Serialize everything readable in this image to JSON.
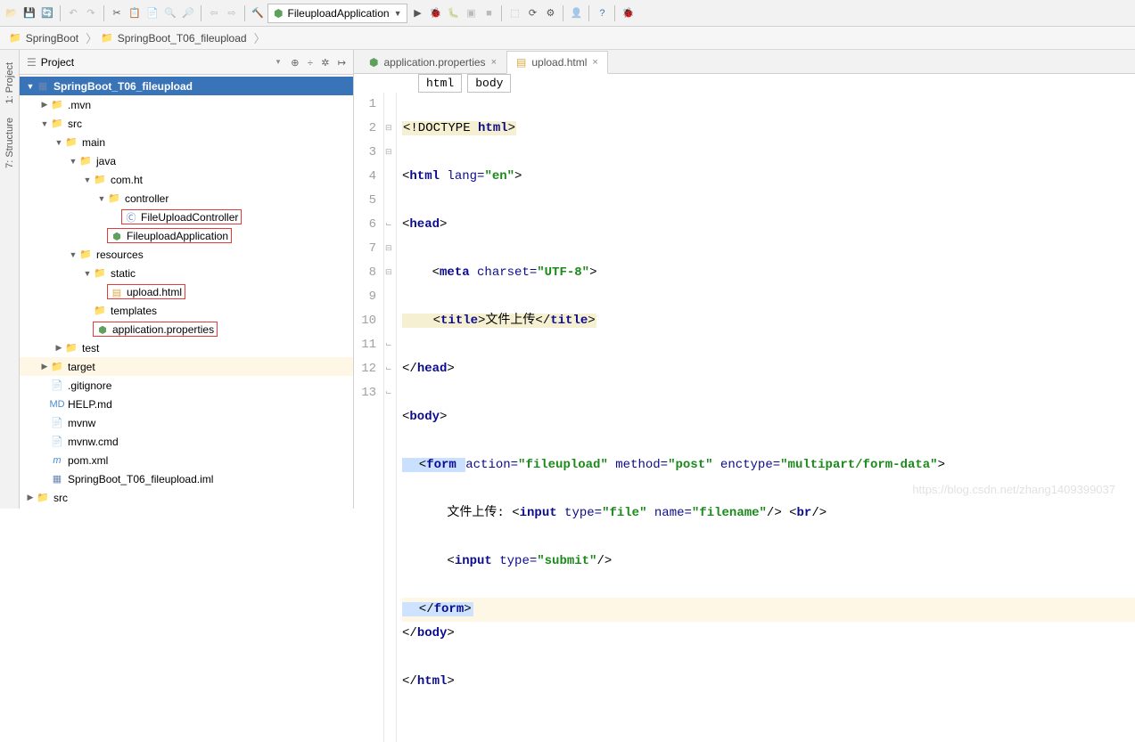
{
  "toolbar": {
    "run_config": "FileuploadApplication"
  },
  "breadcrumb": {
    "root": "SpringBoot",
    "module": "SpringBoot_T06_fileupload"
  },
  "project_panel": {
    "title": "Project",
    "tree": {
      "root": "SpringBoot_T06_fileupload",
      "mvn": ".mvn",
      "src": "src",
      "main": "main",
      "java": "java",
      "com_ht": "com.ht",
      "controller": "controller",
      "ctrl_class": "FileUploadController",
      "app_class": "FileuploadApplication",
      "resources": "resources",
      "static": "static",
      "upload_html": "upload.html",
      "templates": "templates",
      "app_props": "application.properties",
      "test": "test",
      "target": "target",
      "gitignore": ".gitignore",
      "help": "HELP.md",
      "mvnw": "mvnw",
      "mvnwcmd": "mvnw.cmd",
      "pom": "pom.xml",
      "iml": "SpringBoot_T06_fileupload.iml",
      "src2": "src"
    }
  },
  "tabs": {
    "t0": "application.properties",
    "t1": "upload.html"
  },
  "path_bar": {
    "seg0": "html",
    "seg1": "body"
  },
  "editor": {
    "lines": {
      "n1": "1",
      "n2": "2",
      "n3": "3",
      "n4": "4",
      "n5": "5",
      "n6": "6",
      "n7": "7",
      "n8": "8",
      "n9": "9",
      "n10": "10",
      "n11": "11",
      "n12": "12",
      "n13": "13"
    },
    "l1_doctype": "<!DOCTYPE ",
    "l1_html": "html",
    "l1_close": ">",
    "l2_open": "<",
    "l2_tag": "html ",
    "l2_attr": "lang=",
    "l2_val": "\"en\"",
    "l2_close": ">",
    "l3": "<",
    "l3_tag": "head",
    "l3_close": ">",
    "l4_open": "    <",
    "l4_tag": "meta ",
    "l4_attr": "charset=",
    "l4_val": "\"UTF-8\"",
    "l4_close": ">",
    "l5_open": "    <",
    "l5_tag": "title",
    "l5_mid": ">文件上传</",
    "l5_tag2": "title",
    "l5_close": ">",
    "l6_open": "</",
    "l6_tag": "head",
    "l6_close": ">",
    "l7_open": "<",
    "l7_tag": "body",
    "l7_close": ">",
    "l8_open": "  <",
    "l8_tag": "form ",
    "l8_a1": "action=",
    "l8_v1": "\"fileupload\"",
    "l8_a2": " method=",
    "l8_v2": "\"post\"",
    "l8_a3": " enctype=",
    "l8_v3": "\"multipart/form-data\"",
    "l8_close": ">",
    "l9_text": "      文件上传: <",
    "l9_tag": "input ",
    "l9_a1": "type=",
    "l9_v1": "\"file\"",
    "l9_a2": " name=",
    "l9_v2": "\"filename\"",
    "l9_close": "/> <",
    "l9_tag2": "br",
    "l9_close2": "/>",
    "l10_text": "      <",
    "l10_tag": "input ",
    "l10_a1": "type=",
    "l10_v1": "\"submit\"",
    "l10_close": "/>",
    "l11_open": "  </",
    "l11_tag": "form",
    "l11_close": ">",
    "l12_open": "</",
    "l12_tag": "body",
    "l12_close": ">",
    "l13_open": "</",
    "l13_tag": "html",
    "l13_close": ">"
  },
  "side_tabs": {
    "t0": "1: Project",
    "t1": "7: Structure"
  },
  "watermark": "https://blog.csdn.net/zhang1409399037"
}
